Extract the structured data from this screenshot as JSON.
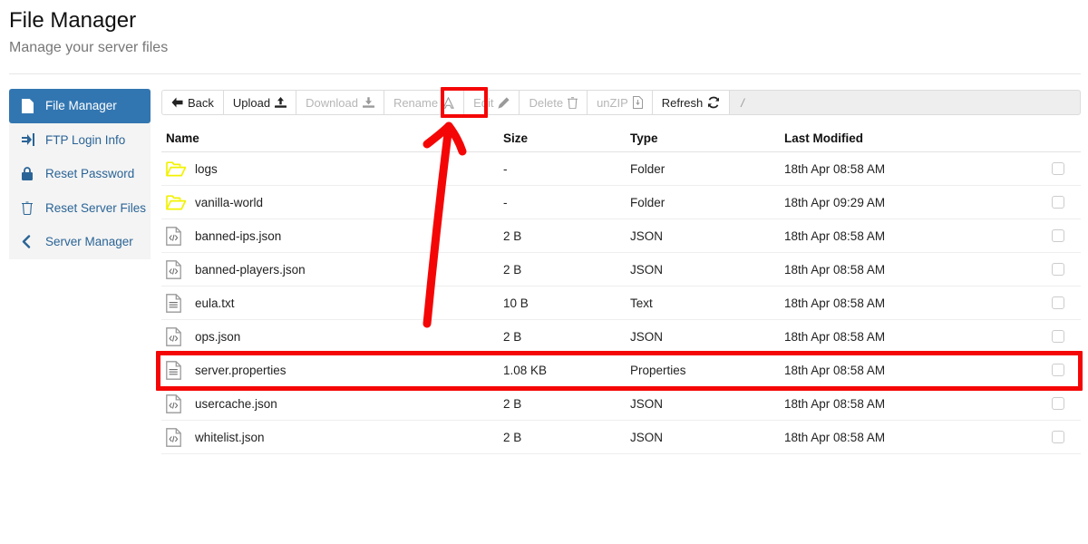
{
  "header": {
    "title": "File Manager",
    "subtitle": "Manage your server files"
  },
  "sidebar": {
    "items": [
      {
        "label": "File Manager",
        "icon": "file-icon",
        "active": true
      },
      {
        "label": "FTP Login Info",
        "icon": "signin-icon",
        "active": false
      },
      {
        "label": "Reset Password",
        "icon": "lock-icon",
        "active": false
      },
      {
        "label": "Reset Server Files",
        "icon": "trash-icon",
        "active": false
      },
      {
        "label": "Server Manager",
        "icon": "chevron-left-icon",
        "active": false
      }
    ]
  },
  "toolbar": {
    "buttons": [
      {
        "label": "Back",
        "icon": "arrow-left-icon",
        "icon_side": "left",
        "disabled": false
      },
      {
        "label": "Upload",
        "icon": "upload-icon",
        "icon_side": "right",
        "disabled": false
      },
      {
        "label": "Download",
        "icon": "download-icon",
        "icon_side": "right",
        "disabled": true
      },
      {
        "label": "Rename",
        "icon": "text-cursor-icon",
        "icon_side": "right",
        "disabled": true
      },
      {
        "label": "Edit",
        "icon": "pencil-icon",
        "icon_side": "right",
        "disabled": true
      },
      {
        "label": "Delete",
        "icon": "trash-icon",
        "icon_side": "right",
        "disabled": true
      },
      {
        "label": "unZIP",
        "icon": "file-archive-icon",
        "icon_side": "right",
        "disabled": true
      },
      {
        "label": "Refresh",
        "icon": "refresh-icon",
        "icon_side": "right",
        "disabled": false
      }
    ],
    "path": "/"
  },
  "table": {
    "columns": [
      "Name",
      "Size",
      "Type",
      "Last Modified"
    ],
    "rows": [
      {
        "name": "logs",
        "size": "-",
        "type": "Folder",
        "modified": "18th Apr 08:58 AM",
        "icon": "folder-icon",
        "checked": false
      },
      {
        "name": "vanilla-world",
        "size": "-",
        "type": "Folder",
        "modified": "18th Apr 09:29 AM",
        "icon": "folder-icon",
        "checked": false
      },
      {
        "name": "banned-ips.json",
        "size": "2 B",
        "type": "JSON",
        "modified": "18th Apr 08:58 AM",
        "icon": "code-file-icon",
        "checked": false
      },
      {
        "name": "banned-players.json",
        "size": "2 B",
        "type": "JSON",
        "modified": "18th Apr 08:58 AM",
        "icon": "code-file-icon",
        "checked": false
      },
      {
        "name": "eula.txt",
        "size": "10 B",
        "type": "Text",
        "modified": "18th Apr 08:58 AM",
        "icon": "text-file-icon",
        "checked": false
      },
      {
        "name": "ops.json",
        "size": "2 B",
        "type": "JSON",
        "modified": "18th Apr 08:58 AM",
        "icon": "code-file-icon",
        "checked": false
      },
      {
        "name": "server.properties",
        "size": "1.08 KB",
        "type": "Properties",
        "modified": "18th Apr 08:58 AM",
        "icon": "text-file-icon",
        "checked": false
      },
      {
        "name": "usercache.json",
        "size": "2 B",
        "type": "JSON",
        "modified": "18th Apr 08:58 AM",
        "icon": "code-file-icon",
        "checked": false
      },
      {
        "name": "whitelist.json",
        "size": "2 B",
        "type": "JSON",
        "modified": "18th Apr 08:58 AM",
        "icon": "code-file-icon",
        "checked": false
      }
    ]
  },
  "annotations": {
    "highlight_color": "#f50606",
    "edit_button_box": "Edit",
    "highlighted_row": "server.properties",
    "arrow": "red-arrow-pointing-to-edit-button"
  },
  "colors": {
    "accent_blue": "#3276b1",
    "link_blue": "#2a6496",
    "sidebar_bg": "#f4f4f4",
    "folder_yellow": "#f2f200",
    "annotation_red": "#f50606"
  }
}
